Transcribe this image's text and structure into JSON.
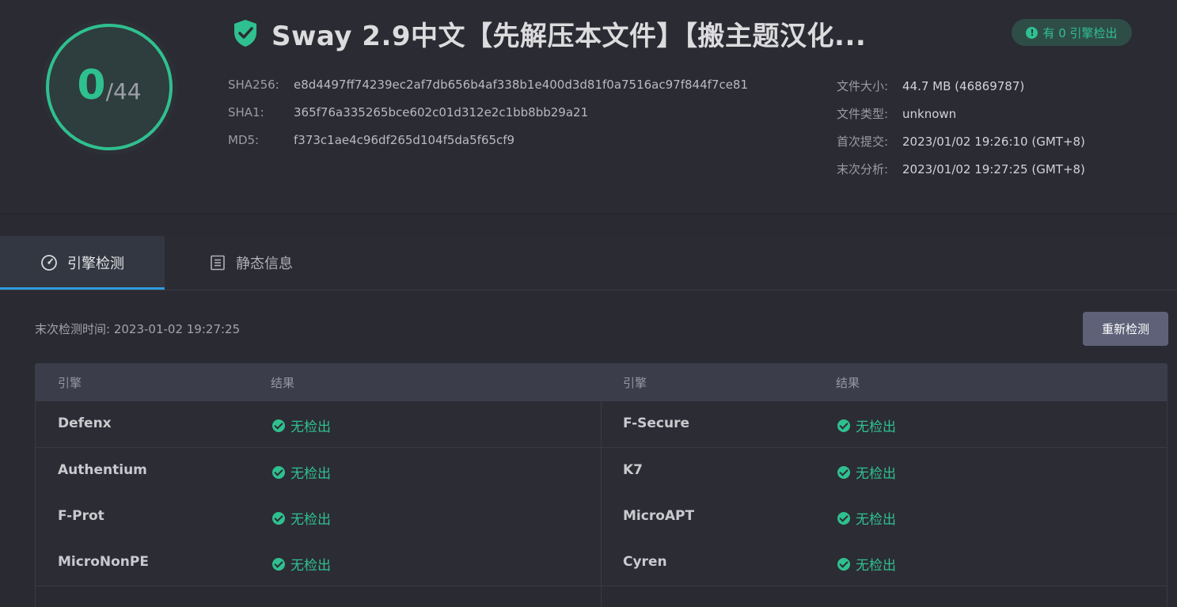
{
  "file": {
    "title": "Sway 2.9中文【先解压本文件】【搬主题汉化...",
    "score": "0",
    "total": "/44",
    "badge_label": "有 0 引擎检出",
    "hashes": [
      {
        "label": "SHA256:",
        "value": "e8d4497ff74239ec2af7db656b4af338b1e400d3d81f0a7516ac97f844f7ce81"
      },
      {
        "label": "SHA1:",
        "value": "365f76a335265bce602c01d312e2c1bb8bb29a21"
      },
      {
        "label": "MD5:",
        "value": "f373c1ae4c96df265d104f5da5f65cf9"
      }
    ],
    "meta": [
      {
        "label": "文件大小:",
        "value": "44.7 MB (46869787)"
      },
      {
        "label": "文件类型:",
        "value": "unknown"
      },
      {
        "label": "首次提交:",
        "value": "2023/01/02 19:26:10 (GMT+8)"
      },
      {
        "label": "末次分析:",
        "value": "2023/01/02 19:27:25 (GMT+8)"
      }
    ]
  },
  "tabs": [
    {
      "label": "引擎检测",
      "icon": "gauge-icon",
      "active": true
    },
    {
      "label": "静态信息",
      "icon": "document-icon",
      "active": false
    }
  ],
  "scan": {
    "last_scan": "末次检测时间: 2023-01-02 19:27:25",
    "rescan_label": "重新检测"
  },
  "table": {
    "headers": [
      "引擎",
      "结果",
      "引擎",
      "结果"
    ],
    "rows": [
      {
        "left_engine": "Defenx",
        "left_result": "无检出",
        "right_engine": "F-Secure",
        "right_result": "无检出"
      },
      {
        "left_engine": "Authentium",
        "left_result": "无检出",
        "right_engine": "K7",
        "right_result": "无检出"
      },
      {
        "left_engine": "F-Prot",
        "left_result": "无检出",
        "right_engine": "MicroAPT",
        "right_result": "无检出"
      },
      {
        "left_engine": "MicroNonPE",
        "left_result": "无检出",
        "right_engine": "Cyren",
        "right_result": "无检出"
      }
    ]
  },
  "colors": {
    "accent_green": "#2fc08f",
    "tab_underline": "#2d9cdb",
    "button_bg": "#5e6178"
  }
}
